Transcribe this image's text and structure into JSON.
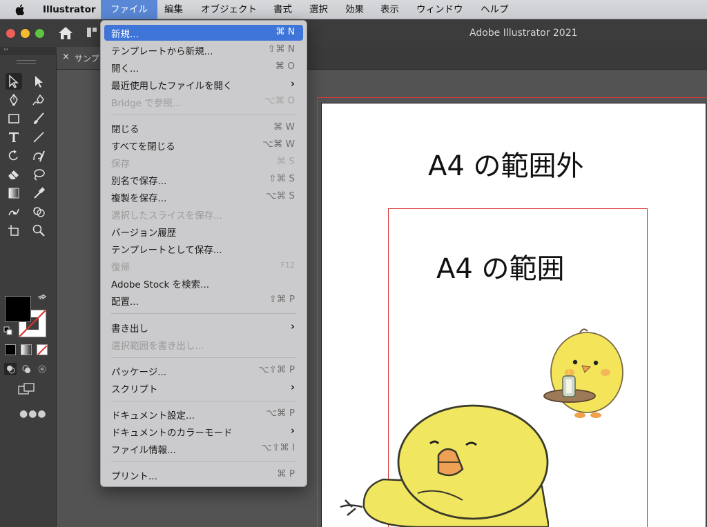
{
  "menubar": {
    "app_name": "Illustrator",
    "items": [
      "ファイル",
      "編集",
      "オブジェクト",
      "書式",
      "選択",
      "効果",
      "表示",
      "ウィンドウ",
      "ヘルプ"
    ]
  },
  "window": {
    "title": "Adobe Illustrator 2021"
  },
  "document_tab": {
    "title": "サンプ",
    "close": "×"
  },
  "file_menu": {
    "items": [
      {
        "label": "新規...",
        "shortcut": "⌘ N",
        "state": "highlighted"
      },
      {
        "label": "テンプレートから新規...",
        "shortcut": "⇧⌘ N"
      },
      {
        "label": "開く...",
        "shortcut": "⌘ O"
      },
      {
        "label": "最近使用したファイルを開く",
        "submenu": "›"
      },
      {
        "label": "Bridge で参照...",
        "shortcut": "⌥⌘ O",
        "state": "disabled"
      },
      {
        "label": "閉じる",
        "shortcut": "⌘ W"
      },
      {
        "label": "すべてを閉じる",
        "shortcut": "⌥⌘ W"
      },
      {
        "label": "保存",
        "shortcut": "⌘ S",
        "state": "disabled"
      },
      {
        "label": "別名で保存...",
        "shortcut": "⇧⌘ S"
      },
      {
        "label": "複製を保存...",
        "shortcut": "⌥⌘ S"
      },
      {
        "label": "選択したスライスを保存...",
        "state": "disabled"
      },
      {
        "label": "バージョン履歴"
      },
      {
        "label": "テンプレートとして保存..."
      },
      {
        "label": "復帰",
        "shortcut": "F12",
        "state": "disabled"
      },
      {
        "label": "Adobe Stock を検索..."
      },
      {
        "label": "配置...",
        "shortcut": "⇧⌘ P"
      },
      {
        "label": "書き出し",
        "submenu": "›"
      },
      {
        "label": "選択範囲を書き出し...",
        "state": "disabled"
      },
      {
        "label": "パッケージ...",
        "shortcut": "⌥⇧⌘ P"
      },
      {
        "label": "スクリプト",
        "submenu": "›"
      },
      {
        "label": "ドキュメント設定...",
        "shortcut": "⌥⌘ P"
      },
      {
        "label": "ドキュメントのカラーモード",
        "submenu": "›"
      },
      {
        "label": "ファイル情報...",
        "shortcut": "⌥⇧⌘ I"
      },
      {
        "label": "プリント...",
        "shortcut": "⌘ P"
      }
    ]
  },
  "artboard": {
    "outside_label": "A4 の範囲外",
    "inside_label": "A4 の範囲"
  },
  "colors": {
    "accent": "#3f74d8",
    "bleed_line": "#d83a3a",
    "chick_yellow": "#f1e660"
  },
  "tools": [
    "selection-tool",
    "direct-selection-tool",
    "pen-tool",
    "curvature-tool",
    "rectangle-tool",
    "paintbrush-tool",
    "type-tool",
    "line-tool",
    "rotate-tool",
    "shaper-tool",
    "eraser-tool",
    "lasso-tool",
    "gradient-tool",
    "eyedropper-tool",
    "puppet-warp-tool",
    "shape-builder-tool",
    "artboard-tool",
    "zoom-tool"
  ]
}
